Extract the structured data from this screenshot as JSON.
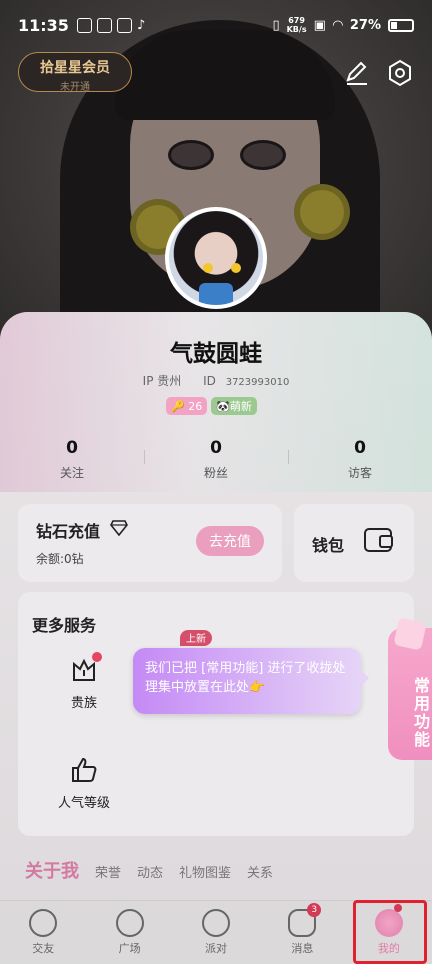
{
  "status_bar": {
    "time": "11:35",
    "net_speed": "679\nKB/s",
    "battery": "27%"
  },
  "member": {
    "title": "拾星星会员",
    "subtitle": "未开通"
  },
  "profile": {
    "name": "气鼓圆蛙",
    "ip_location": "IP 贵州",
    "id_label": "ID",
    "id_value": "3723993010",
    "level_tag": "26",
    "newbie_tag": "萌新"
  },
  "stats": [
    {
      "value": "0",
      "label": "关注"
    },
    {
      "value": "0",
      "label": "粉丝"
    },
    {
      "value": "0",
      "label": "访客"
    }
  ],
  "diamond": {
    "title": "钻石充值",
    "balance": "余额:0钻",
    "button": "去充值"
  },
  "wallet": {
    "title": "钱包"
  },
  "services": {
    "title": "更多服务",
    "new_badge": "上新",
    "items": [
      {
        "label": "贵族",
        "icon": "crown-icon"
      },
      {
        "label": "人气等级",
        "icon": "thumbs-up-icon"
      }
    ]
  },
  "tooltip": {
    "text": "我们已把 [常用功能] 进行了收拢处理集中放置在此处👉"
  },
  "side_tab": {
    "label": "常用功能"
  },
  "about": {
    "main": "关于我",
    "tabs": [
      "荣誉",
      "动态",
      "礼物图鉴",
      "关系"
    ]
  },
  "tabbar": {
    "items": [
      {
        "label": "交友",
        "icon": "friends-icon"
      },
      {
        "label": "广场",
        "icon": "compass-icon"
      },
      {
        "label": "派对",
        "icon": "music-note-icon"
      },
      {
        "label": "消息",
        "icon": "message-icon",
        "badge": "3"
      },
      {
        "label": "我的",
        "icon": "profile-icon",
        "active": true
      }
    ]
  },
  "colors": {
    "accent_pink": "#e99fbd",
    "tooltip_purple": "#c48af5",
    "highlight_red": "#e0212f"
  }
}
